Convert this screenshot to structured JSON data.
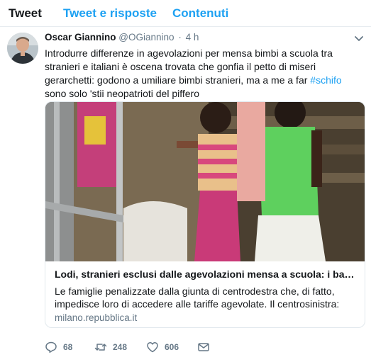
{
  "tabs": [
    {
      "label": "Tweet"
    },
    {
      "label": "Tweet e risposte"
    },
    {
      "label": "Contenuti"
    }
  ],
  "tweet": {
    "name": "Oscar Giannino",
    "handle": "@OGiannino",
    "separator": "·",
    "time": "4 h",
    "text_before": "Introdurre differenze in agevolazioni per mensa bimbi a scuola tra stranieri e italiani è oscena trovata che gonfia il petto di miseri gerarchetti: godono a umiliare bimbi stranieri, ma a me a far ",
    "hashtag": "#schifo",
    "text_after": " sono solo 'stii neopatrioti del piffero",
    "card": {
      "title": "Lodi, stranieri esclusi dalle agevolazioni mensa a scuola: i bambini costretti a mangiare da soli",
      "description": "Le famiglie penalizzate dalla giunta di centrodestra che, di fatto, impedisce loro di accedere alle tariffe agevolate. Il centrosinistra:",
      "domain": "milano.repubblica.it"
    },
    "actions": {
      "replies": "68",
      "retweets": "248",
      "likes": "606"
    }
  },
  "colors": {
    "link": "#1da1f2",
    "muted": "#657786",
    "text": "#14171a"
  },
  "icons": [
    "chevron-down-icon",
    "reply-icon",
    "retweet-icon",
    "like-icon",
    "message-icon"
  ]
}
